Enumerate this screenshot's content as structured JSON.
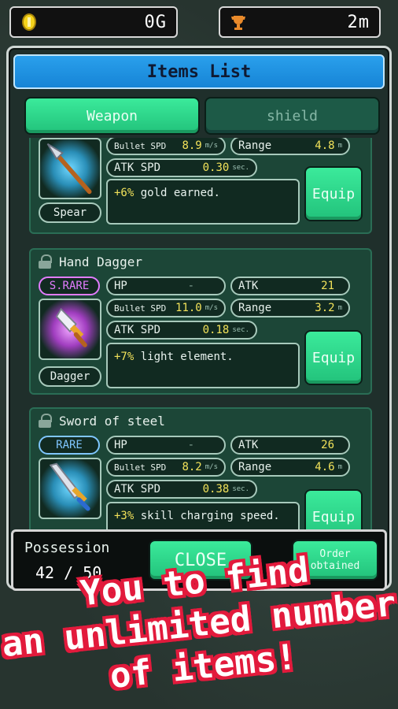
{
  "hud": {
    "gold": "0G",
    "distance": "2m"
  },
  "panel": {
    "title": "Items List",
    "tabs": [
      "Weapon",
      "shield"
    ]
  },
  "items": [
    {
      "type": "Spear",
      "bullet_spd_label": "Bullet SPD",
      "bullet_spd": "8.9",
      "bullet_spd_unit": "m/s",
      "range_label": "Range",
      "range": "4.8",
      "range_unit": "m",
      "atk_spd_label": "ATK SPD",
      "atk_spd": "0.30",
      "atk_spd_unit": "sec.",
      "bonus_value": "+6%",
      "bonus_text": " gold earned.",
      "equip_label": "Equip"
    },
    {
      "name": "Hand Dagger",
      "rarity": "S.RARE",
      "type": "Dagger",
      "hp_label": "HP",
      "hp": "-",
      "atk_label": "ATK",
      "atk": "21",
      "bullet_spd_label": "Bullet SPD",
      "bullet_spd": "11.0",
      "bullet_spd_unit": "m/s",
      "range_label": "Range",
      "range": "3.2",
      "range_unit": "m",
      "atk_spd_label": "ATK SPD",
      "atk_spd": "0.18",
      "atk_spd_unit": "sec.",
      "bonus_value": "+7%",
      "bonus_text": " light element.",
      "equip_label": "Equip"
    },
    {
      "name": "Sword of steel",
      "rarity": "RARE",
      "hp_label": "HP",
      "hp": "-",
      "atk_label": "ATK",
      "atk": "26",
      "bullet_spd_label": "Bullet SPD",
      "bullet_spd": "8.2",
      "bullet_spd_unit": "m/s",
      "range_label": "Range",
      "range": "4.6",
      "range_unit": "m",
      "atk_spd_label": "ATK SPD",
      "atk_spd": "0.38",
      "atk_spd_unit": "sec.",
      "bonus_value": "+3%",
      "bonus_text": " skill charging speed.",
      "equip_label": "Equip"
    }
  ],
  "bottom": {
    "possession_label": "Possession",
    "possession_value": "42 / 50",
    "close_label": "CLOSE",
    "order_line1": "Order",
    "order_line2": "obtained"
  },
  "promo": {
    "line1": "You to find",
    "line2": "an unlimited number",
    "line3": "of items!"
  },
  "colors": {
    "s_rare": "#e27cff",
    "rare": "#7fc6ff",
    "accent_green": "#2fd68a",
    "title_blue": "#1f8fe0",
    "promo_outline": "#e21a3c"
  }
}
